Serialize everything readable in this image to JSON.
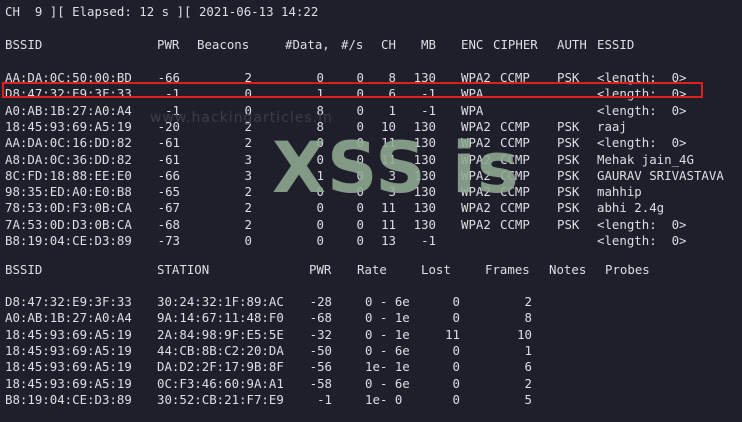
{
  "status_line": "CH  9 ][ Elapsed: 12 s ][ 2021-06-13 14:22",
  "ap_headers": {
    "bssid": "BSSID",
    "pwr": "PWR",
    "beacons": "Beacons",
    "data": "#Data,",
    "rate": "#/s",
    "ch": "CH",
    "mb": "MB",
    "enc": "ENC",
    "cipher": "CIPHER",
    "auth": "AUTH",
    "essid": "ESSID"
  },
  "access_points": [
    {
      "bssid": "AA:DA:0C:50:00:BD",
      "pwr": "-66",
      "beacons": "2",
      "data": "0",
      "rate": "0",
      "ch": "8",
      "mb": "130",
      "enc": "WPA2",
      "cipher": "CCMP",
      "auth": "PSK",
      "essid": "<length:  0>"
    },
    {
      "bssid": "D8:47:32:E9:3F:33",
      "pwr": "-1",
      "beacons": "0",
      "data": "1",
      "rate": "0",
      "ch": "6",
      "mb": "-1",
      "enc": "WPA",
      "cipher": "",
      "auth": "",
      "essid": "<length:  0>"
    },
    {
      "bssid": "A0:AB:1B:27:A0:A4",
      "pwr": "-1",
      "beacons": "0",
      "data": "8",
      "rate": "0",
      "ch": "1",
      "mb": "-1",
      "enc": "WPA",
      "cipher": "",
      "auth": "",
      "essid": "<length:  0>"
    },
    {
      "bssid": "18:45:93:69:A5:19",
      "pwr": "-20",
      "beacons": "2",
      "data": "8",
      "rate": "0",
      "ch": "10",
      "mb": "130",
      "enc": "WPA2",
      "cipher": "CCMP",
      "auth": "PSK",
      "essid": "raaj"
    },
    {
      "bssid": "AA:DA:0C:16:DD:82",
      "pwr": "-61",
      "beacons": "2",
      "data": "0",
      "rate": "0",
      "ch": "11",
      "mb": "130",
      "enc": "WPA2",
      "cipher": "CCMP",
      "auth": "PSK",
      "essid": "<length:  0>"
    },
    {
      "bssid": "A8:DA:0C:36:DD:82",
      "pwr": "-61",
      "beacons": "3",
      "data": "0",
      "rate": "0",
      "ch": "11",
      "mb": "130",
      "enc": "WPA2",
      "cipher": "CCMP",
      "auth": "PSK",
      "essid": "Mehak jain_4G"
    },
    {
      "bssid": "8C:FD:18:88:EE:E0",
      "pwr": "-66",
      "beacons": "3",
      "data": "1",
      "rate": "0",
      "ch": "3",
      "mb": "130",
      "enc": "WPA2",
      "cipher": "CCMP",
      "auth": "PSK",
      "essid": "GAURAV SRIVASTAVA"
    },
    {
      "bssid": "98:35:ED:A0:E0:B8",
      "pwr": "-65",
      "beacons": "2",
      "data": "0",
      "rate": "0",
      "ch": "3",
      "mb": "130",
      "enc": "WPA2",
      "cipher": "CCMP",
      "auth": "PSK",
      "essid": "mahhip"
    },
    {
      "bssid": "78:53:0D:F3:0B:CA",
      "pwr": "-67",
      "beacons": "2",
      "data": "0",
      "rate": "0",
      "ch": "11",
      "mb": "130",
      "enc": "WPA2",
      "cipher": "CCMP",
      "auth": "PSK",
      "essid": "abhi 2.4g"
    },
    {
      "bssid": "7A:53:0D:D3:0B:CA",
      "pwr": "-68",
      "beacons": "2",
      "data": "0",
      "rate": "0",
      "ch": "11",
      "mb": "130",
      "enc": "WPA2",
      "cipher": "CCMP",
      "auth": "PSK",
      "essid": "<length:  0>"
    },
    {
      "bssid": "B8:19:04:CE:D3:89",
      "pwr": "-73",
      "beacons": "0",
      "data": "0",
      "rate": "0",
      "ch": "13",
      "mb": "-1",
      "enc": "",
      "cipher": "",
      "auth": "",
      "essid": "<length:  0>"
    }
  ],
  "station_headers": {
    "bssid": "BSSID",
    "station": "STATION",
    "pwr": "PWR",
    "rate": "Rate",
    "lost": "Lost",
    "frames": "Frames",
    "notes": "Notes",
    "probes": "Probes"
  },
  "stations": [
    {
      "bssid": "D8:47:32:E9:3F:33",
      "station": "30:24:32:1F:89:AC",
      "pwr": "-28",
      "rate": "0 - 6e",
      "lost": "0",
      "frames": "2"
    },
    {
      "bssid": "A0:AB:1B:27:A0:A4",
      "station": "9A:14:67:11:48:F0",
      "pwr": "-68",
      "rate": "0 - 1e",
      "lost": "0",
      "frames": "8"
    },
    {
      "bssid": "18:45:93:69:A5:19",
      "station": "2A:84:98:9F:E5:5E",
      "pwr": "-32",
      "rate": "0 - 1e",
      "lost": "11",
      "frames": "10"
    },
    {
      "bssid": "18:45:93:69:A5:19",
      "station": "44:CB:8B:C2:20:DA",
      "pwr": "-50",
      "rate": "0 - 6e",
      "lost": "0",
      "frames": "1"
    },
    {
      "bssid": "18:45:93:69:A5:19",
      "station": "DA:D2:2F:17:9B:8F",
      "pwr": "-56",
      "rate": "1e- 1e",
      "lost": "0",
      "frames": "6"
    },
    {
      "bssid": "18:45:93:69:A5:19",
      "station": "0C:F3:46:60:9A:A1",
      "pwr": "-58",
      "rate": "0 - 6e",
      "lost": "0",
      "frames": "2"
    },
    {
      "bssid": "B8:19:04:CE:D3:89",
      "station": "30:52:CB:21:F7:E9",
      "pwr": "-1",
      "rate": "1e- 0",
      "lost": "0",
      "frames": "5"
    }
  ],
  "watermark": {
    "text": "XSS is",
    "url": "www.hackingarticles.in"
  },
  "colors": {
    "background": "#1e1f2a",
    "text": "#dedfe3",
    "highlight": "#e0201e",
    "watermark": "#8faa92"
  }
}
